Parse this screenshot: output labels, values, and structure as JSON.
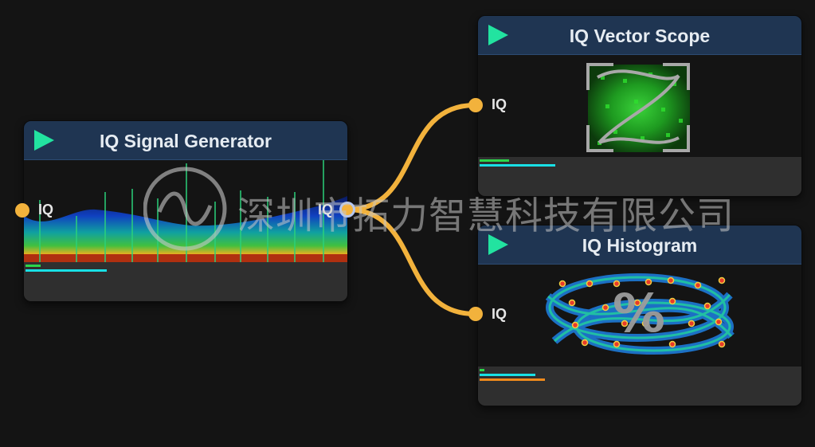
{
  "colors": {
    "canvas_bg": "#141414",
    "header_bg": "#1f3552",
    "wire": "#f2b23c",
    "play": "#22e3a0",
    "meter_green": "#2bd64a",
    "meter_cyan": "#19e0e6",
    "meter_orange": "#f08a1c"
  },
  "watermark": {
    "icon": "sine-wave-circle-icon",
    "text": "深圳市拓力智慧科技有限公司"
  },
  "nodes": {
    "generator": {
      "title": "IQ Signal Generator",
      "input_label": "IQ",
      "output_label": "IQ",
      "preview_icon": "spectrum-waterfall-preview"
    },
    "vector_scope": {
      "title": "IQ Vector Scope",
      "input_label": "IQ",
      "preview_icon": "vector-scope-constellation-preview"
    },
    "histogram": {
      "title": "IQ Histogram",
      "input_label": "IQ",
      "preview_icon": "percent-histogram-heatmap-preview"
    }
  }
}
